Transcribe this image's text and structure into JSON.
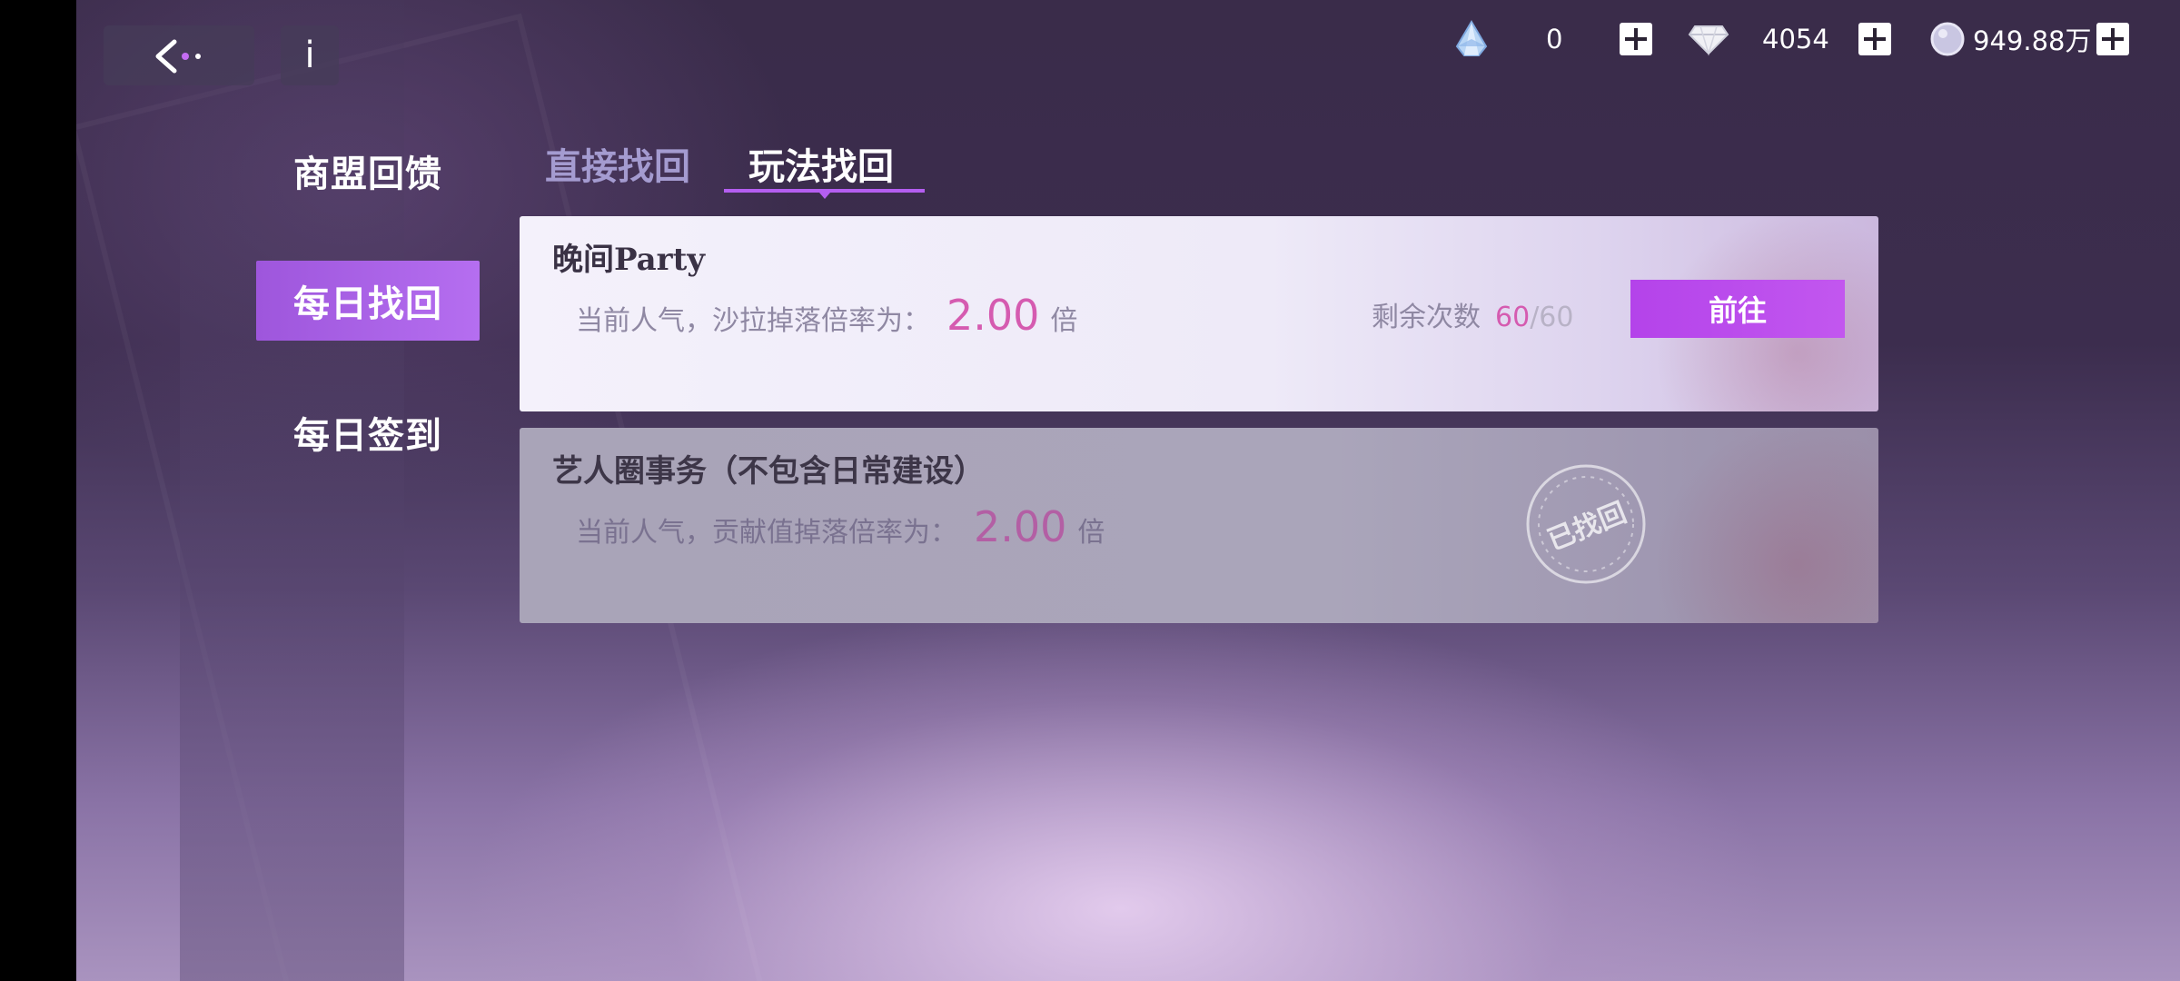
{
  "top_bar": {
    "info_label": "i",
    "currencies": [
      {
        "icon": "crystal-icon",
        "value": "0"
      },
      {
        "icon": "diamond-icon",
        "value": "4054"
      },
      {
        "icon": "silver-coin-icon",
        "value": "949.88万"
      }
    ]
  },
  "sidebar": {
    "items": [
      {
        "label": "商盟回馈",
        "active": false
      },
      {
        "label": "每日找回",
        "active": true
      },
      {
        "label": "每日签到",
        "active": false
      }
    ]
  },
  "tabs": [
    {
      "label": "直接找回",
      "active": false
    },
    {
      "label": "玩法找回",
      "active": true
    }
  ],
  "cards": [
    {
      "title": "晚间Party",
      "rate_prefix": "当前人气，沙拉掉落倍率为：",
      "rate_value": "2.00",
      "rate_suffix": "倍",
      "remain_label": "剩余次数",
      "remain_count": "60",
      "remain_sep": "/",
      "remain_total": "60",
      "button_label": "前往"
    },
    {
      "title": "艺人圈事务（不包含日常建设）",
      "rate_prefix": "当前人气，贡献值掉落倍率为：",
      "rate_value": "2.00",
      "rate_suffix": "倍",
      "stamp_label": "已找回"
    }
  ],
  "colors": {
    "accent": "#b443ea",
    "highlight_value": "#d55bb0",
    "tab_inactive": "#a49bd0"
  }
}
